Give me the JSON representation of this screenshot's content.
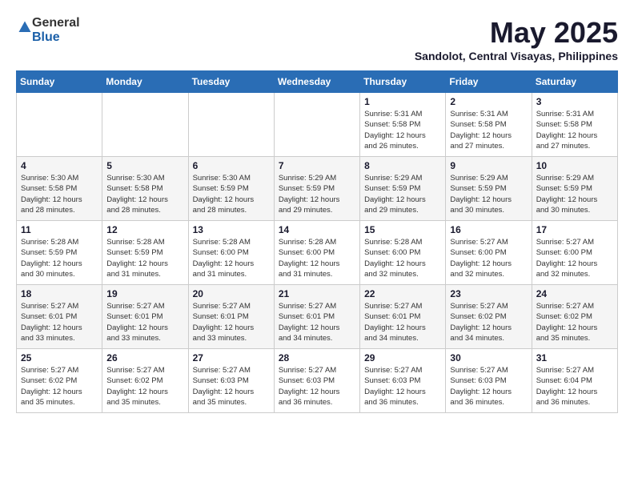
{
  "header": {
    "logo": {
      "general": "General",
      "blue": "Blue"
    },
    "title": "May 2025",
    "location": "Sandolot, Central Visayas, Philippines"
  },
  "calendar": {
    "weekdays": [
      "Sunday",
      "Monday",
      "Tuesday",
      "Wednesday",
      "Thursday",
      "Friday",
      "Saturday"
    ],
    "rows": [
      [
        {
          "day": "",
          "info": ""
        },
        {
          "day": "",
          "info": ""
        },
        {
          "day": "",
          "info": ""
        },
        {
          "day": "",
          "info": ""
        },
        {
          "day": "1",
          "info": "Sunrise: 5:31 AM\nSunset: 5:58 PM\nDaylight: 12 hours\nand 26 minutes."
        },
        {
          "day": "2",
          "info": "Sunrise: 5:31 AM\nSunset: 5:58 PM\nDaylight: 12 hours\nand 27 minutes."
        },
        {
          "day": "3",
          "info": "Sunrise: 5:31 AM\nSunset: 5:58 PM\nDaylight: 12 hours\nand 27 minutes."
        }
      ],
      [
        {
          "day": "4",
          "info": "Sunrise: 5:30 AM\nSunset: 5:58 PM\nDaylight: 12 hours\nand 28 minutes."
        },
        {
          "day": "5",
          "info": "Sunrise: 5:30 AM\nSunset: 5:58 PM\nDaylight: 12 hours\nand 28 minutes."
        },
        {
          "day": "6",
          "info": "Sunrise: 5:30 AM\nSunset: 5:59 PM\nDaylight: 12 hours\nand 28 minutes."
        },
        {
          "day": "7",
          "info": "Sunrise: 5:29 AM\nSunset: 5:59 PM\nDaylight: 12 hours\nand 29 minutes."
        },
        {
          "day": "8",
          "info": "Sunrise: 5:29 AM\nSunset: 5:59 PM\nDaylight: 12 hours\nand 29 minutes."
        },
        {
          "day": "9",
          "info": "Sunrise: 5:29 AM\nSunset: 5:59 PM\nDaylight: 12 hours\nand 30 minutes."
        },
        {
          "day": "10",
          "info": "Sunrise: 5:29 AM\nSunset: 5:59 PM\nDaylight: 12 hours\nand 30 minutes."
        }
      ],
      [
        {
          "day": "11",
          "info": "Sunrise: 5:28 AM\nSunset: 5:59 PM\nDaylight: 12 hours\nand 30 minutes."
        },
        {
          "day": "12",
          "info": "Sunrise: 5:28 AM\nSunset: 5:59 PM\nDaylight: 12 hours\nand 31 minutes."
        },
        {
          "day": "13",
          "info": "Sunrise: 5:28 AM\nSunset: 6:00 PM\nDaylight: 12 hours\nand 31 minutes."
        },
        {
          "day": "14",
          "info": "Sunrise: 5:28 AM\nSunset: 6:00 PM\nDaylight: 12 hours\nand 31 minutes."
        },
        {
          "day": "15",
          "info": "Sunrise: 5:28 AM\nSunset: 6:00 PM\nDaylight: 12 hours\nand 32 minutes."
        },
        {
          "day": "16",
          "info": "Sunrise: 5:27 AM\nSunset: 6:00 PM\nDaylight: 12 hours\nand 32 minutes."
        },
        {
          "day": "17",
          "info": "Sunrise: 5:27 AM\nSunset: 6:00 PM\nDaylight: 12 hours\nand 32 minutes."
        }
      ],
      [
        {
          "day": "18",
          "info": "Sunrise: 5:27 AM\nSunset: 6:01 PM\nDaylight: 12 hours\nand 33 minutes."
        },
        {
          "day": "19",
          "info": "Sunrise: 5:27 AM\nSunset: 6:01 PM\nDaylight: 12 hours\nand 33 minutes."
        },
        {
          "day": "20",
          "info": "Sunrise: 5:27 AM\nSunset: 6:01 PM\nDaylight: 12 hours\nand 33 minutes."
        },
        {
          "day": "21",
          "info": "Sunrise: 5:27 AM\nSunset: 6:01 PM\nDaylight: 12 hours\nand 34 minutes."
        },
        {
          "day": "22",
          "info": "Sunrise: 5:27 AM\nSunset: 6:01 PM\nDaylight: 12 hours\nand 34 minutes."
        },
        {
          "day": "23",
          "info": "Sunrise: 5:27 AM\nSunset: 6:02 PM\nDaylight: 12 hours\nand 34 minutes."
        },
        {
          "day": "24",
          "info": "Sunrise: 5:27 AM\nSunset: 6:02 PM\nDaylight: 12 hours\nand 35 minutes."
        }
      ],
      [
        {
          "day": "25",
          "info": "Sunrise: 5:27 AM\nSunset: 6:02 PM\nDaylight: 12 hours\nand 35 minutes."
        },
        {
          "day": "26",
          "info": "Sunrise: 5:27 AM\nSunset: 6:02 PM\nDaylight: 12 hours\nand 35 minutes."
        },
        {
          "day": "27",
          "info": "Sunrise: 5:27 AM\nSunset: 6:03 PM\nDaylight: 12 hours\nand 35 minutes."
        },
        {
          "day": "28",
          "info": "Sunrise: 5:27 AM\nSunset: 6:03 PM\nDaylight: 12 hours\nand 36 minutes."
        },
        {
          "day": "29",
          "info": "Sunrise: 5:27 AM\nSunset: 6:03 PM\nDaylight: 12 hours\nand 36 minutes."
        },
        {
          "day": "30",
          "info": "Sunrise: 5:27 AM\nSunset: 6:03 PM\nDaylight: 12 hours\nand 36 minutes."
        },
        {
          "day": "31",
          "info": "Sunrise: 5:27 AM\nSunset: 6:04 PM\nDaylight: 12 hours\nand 36 minutes."
        }
      ]
    ]
  }
}
